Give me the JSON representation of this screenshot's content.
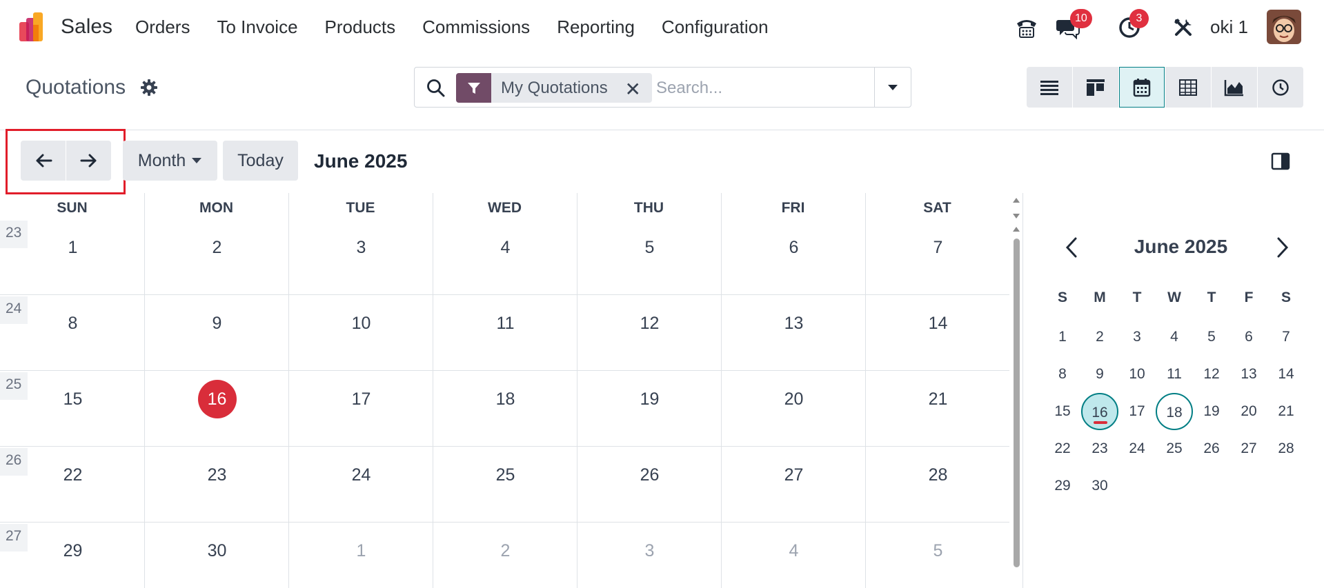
{
  "navbar": {
    "app_name": "Sales",
    "menu": [
      "Orders",
      "To Invoice",
      "Products",
      "Commissions",
      "Reporting",
      "Configuration"
    ],
    "messages_badge": "10",
    "activities_badge": "3",
    "user_name": "oki 1"
  },
  "control_panel": {
    "title": "Quotations",
    "facet_label": "My Quotations",
    "search_placeholder": "Search...",
    "views": [
      "list-icon",
      "kanban-icon",
      "calendar-icon",
      "pivot-icon",
      "graph-icon",
      "activity-icon"
    ],
    "active_view": "calendar"
  },
  "calendar": {
    "scale_label": "Month",
    "today_label": "Today",
    "range_title": "June 2025",
    "weekdays": [
      "SUN",
      "MON",
      "TUE",
      "WED",
      "THU",
      "FRI",
      "SAT"
    ],
    "weeks": [
      {
        "num": "23",
        "days": [
          "1",
          "2",
          "3",
          "4",
          "5",
          "6",
          "7"
        ]
      },
      {
        "num": "24",
        "days": [
          "8",
          "9",
          "10",
          "11",
          "12",
          "13",
          "14"
        ]
      },
      {
        "num": "25",
        "days": [
          "15",
          "16",
          "17",
          "18",
          "19",
          "20",
          "21"
        ]
      },
      {
        "num": "26",
        "days": [
          "22",
          "23",
          "24",
          "25",
          "26",
          "27",
          "28"
        ]
      },
      {
        "num": "27",
        "days": [
          "29",
          "30",
          "1",
          "2",
          "3",
          "4",
          "5"
        ]
      }
    ],
    "today": "16"
  },
  "mini_calendar": {
    "title": "June 2025",
    "weekdays": [
      "S",
      "M",
      "T",
      "W",
      "T",
      "F",
      "S"
    ],
    "rows": [
      [
        "1",
        "2",
        "3",
        "4",
        "5",
        "6",
        "7"
      ],
      [
        "8",
        "9",
        "10",
        "11",
        "12",
        "13",
        "14"
      ],
      [
        "15",
        "16",
        "17",
        "18",
        "19",
        "20",
        "21"
      ],
      [
        "22",
        "23",
        "24",
        "25",
        "26",
        "27",
        "28"
      ],
      [
        "29",
        "30"
      ]
    ],
    "today": "16",
    "selected": "18"
  },
  "colors": {
    "brand": "#714b67",
    "accent": "#017e84",
    "today": "#d92d3a",
    "highlight": "#e11d2a"
  }
}
